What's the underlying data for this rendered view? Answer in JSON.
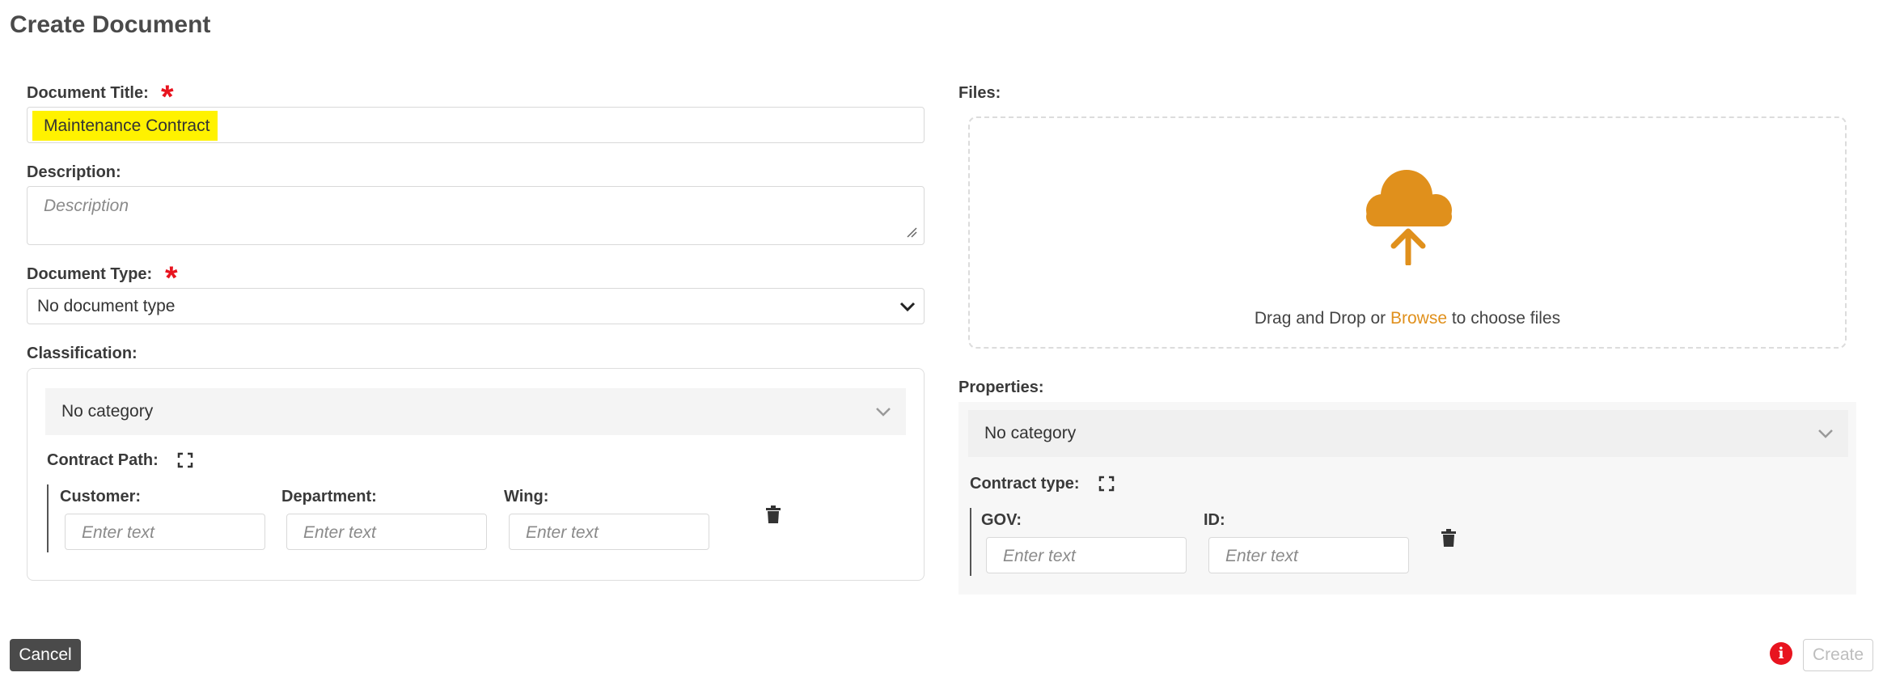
{
  "page": {
    "title": "Create Document"
  },
  "form": {
    "title_label": "Document Title:",
    "title_value": "Maintenance Contract",
    "description_label": "Description:",
    "description_placeholder": "Description",
    "type_label": "Document Type:",
    "type_value": "No document type",
    "classification_label": "Classification:",
    "classification": {
      "category_value": "No category",
      "path_label": "Contract Path:",
      "fields": [
        {
          "label": "Customer:",
          "placeholder": "Enter text"
        },
        {
          "label": "Department:",
          "placeholder": "Enter text"
        },
        {
          "label": "Wing:",
          "placeholder": "Enter text"
        }
      ]
    },
    "required_mark": "*"
  },
  "files": {
    "label": "Files:",
    "drop_text_before": "Drag and Drop or ",
    "browse_text": "Browse",
    "drop_text_after": " to choose files"
  },
  "properties": {
    "label": "Properties:",
    "category_value": "No category",
    "type_label": "Contract type:",
    "fields": [
      {
        "label": "GOV:",
        "placeholder": "Enter text"
      },
      {
        "label": "ID:",
        "placeholder": "Enter text"
      }
    ]
  },
  "actions": {
    "cancel_label": "Cancel",
    "create_label": "Create",
    "error_icon_glyph": "i"
  },
  "colors": {
    "required": "#e8141f",
    "accent": "#e0901c",
    "highlight": "#fff200",
    "cancel_bg": "#4a4a4a"
  },
  "icons": {
    "upload": "cloud-upload-icon",
    "expand": "expand-icon",
    "trash": "trash-icon",
    "chevron": "chevron-down-icon",
    "error": "info-error-icon"
  }
}
